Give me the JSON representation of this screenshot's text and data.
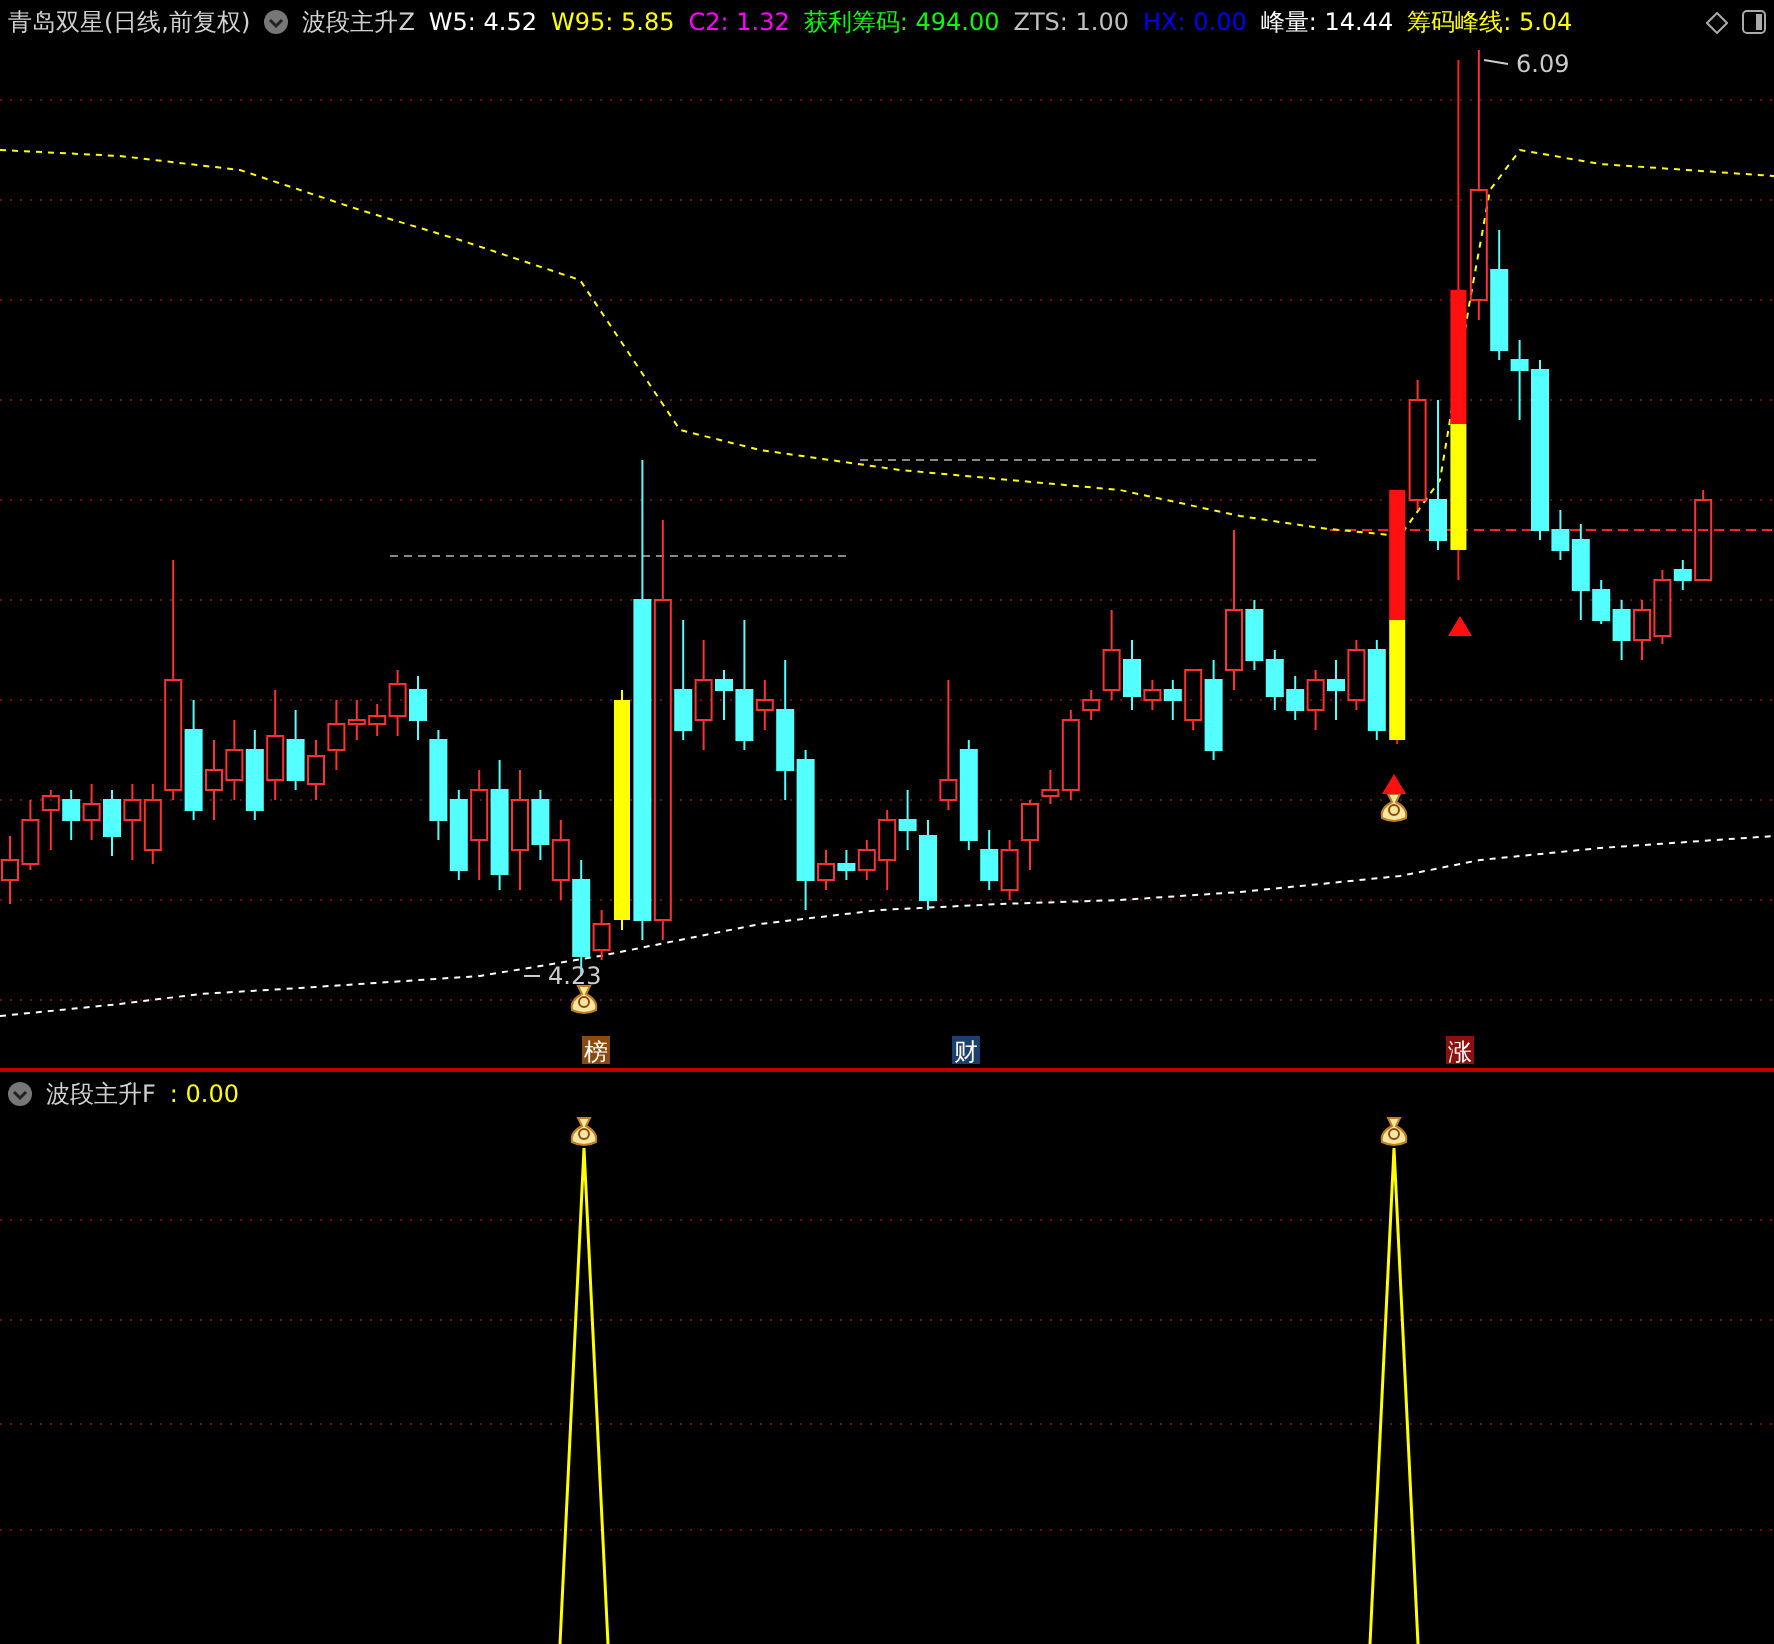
{
  "title": {
    "stock": "青岛双星",
    "period": "(日线,前复权)"
  },
  "main_indicator": {
    "name": "波段主升Z",
    "values": [
      {
        "label": "W5:",
        "value": "4.52",
        "color": "#ffffff"
      },
      {
        "label": "W95:",
        "value": "5.85",
        "color": "#ffff00"
      },
      {
        "label": "C2:",
        "value": "1.32",
        "color": "#ff00ff"
      },
      {
        "label": "获利筹码:",
        "value": "494.00",
        "color": "#00ff00"
      },
      {
        "label": "ZTS:",
        "value": "1.00",
        "color": "#c0c0c0"
      },
      {
        "label": "HX:",
        "value": "0.00",
        "color": "#0000ff"
      },
      {
        "label": "峰量:",
        "value": "14.44",
        "color": "#ffffff"
      },
      {
        "label": "筹码峰线:",
        "value": "5.04",
        "color": "#ffff00"
      }
    ]
  },
  "price_labels": [
    {
      "kind": "high",
      "text": "6.09"
    },
    {
      "kind": "low",
      "text": "4.23"
    }
  ],
  "event_tags": [
    {
      "text": "榜",
      "color": "#8b4a10"
    },
    {
      "text": "财",
      "color": "#1c3f6e"
    },
    {
      "text": "涨",
      "color": "#8b1010"
    }
  ],
  "sub_indicator": {
    "name": "波段主升F",
    "value": ": 0.00"
  }
}
